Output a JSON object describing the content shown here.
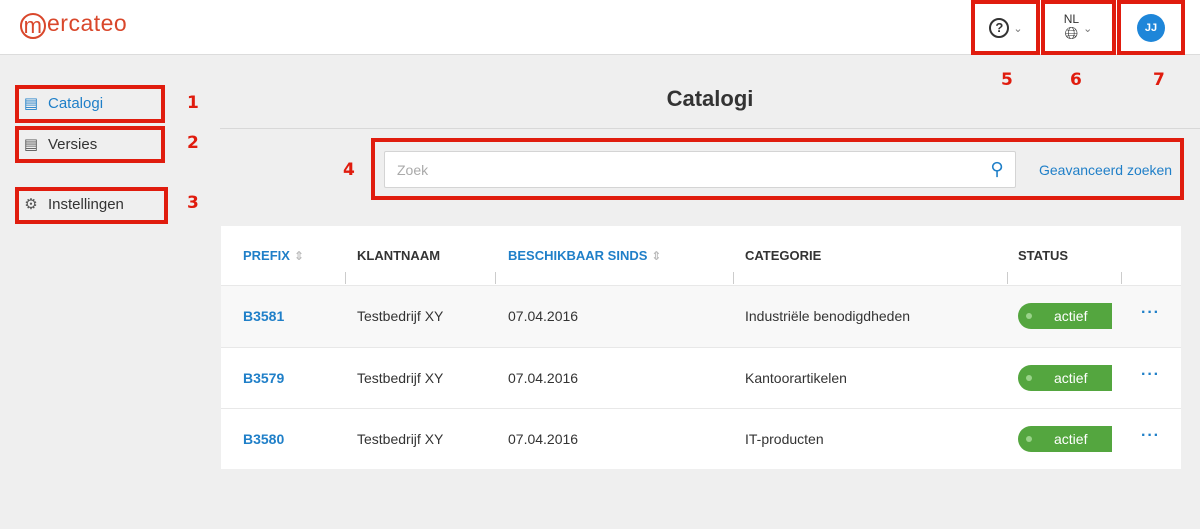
{
  "header": {
    "logo_text": "mercateo",
    "help_icon": "question-circle-icon",
    "language_code": "NL",
    "user_initials": "JJ",
    "accent_color": "#1e86d9",
    "brand_color": "#d9472b"
  },
  "sidebar": {
    "items": [
      {
        "label": "Catalogi",
        "icon": "catalog-icon",
        "active": true
      },
      {
        "label": "Versies",
        "icon": "versions-icon",
        "active": false
      },
      {
        "label": "Instellingen",
        "icon": "gear-icon",
        "active": false
      }
    ]
  },
  "main": {
    "title": "Catalogi",
    "search": {
      "placeholder": "Zoek",
      "value": ""
    },
    "advanced_search_label": "Geavanceerd zoeken"
  },
  "table": {
    "columns": [
      "PREFIX",
      "KLANTNAAM",
      "BESCHIKBAAR SINDS",
      "CATEGORIE",
      "STATUS"
    ],
    "rows": [
      {
        "prefix": "B3581",
        "customer": "Testbedrijf XY",
        "since": "07.04.2016",
        "category": "Industriële benodigdheden",
        "status": "actief"
      },
      {
        "prefix": "B3579",
        "customer": "Testbedrijf XY",
        "since": "07.04.2016",
        "category": "Kantoorartikelen",
        "status": "actief"
      },
      {
        "prefix": "B3580",
        "customer": "Testbedrijf XY",
        "since": "07.04.2016",
        "category": "IT-producten",
        "status": "actief"
      }
    ],
    "status_color": "#54a63f"
  },
  "annotations": [
    "1",
    "2",
    "3",
    "4",
    "5",
    "6",
    "7"
  ]
}
